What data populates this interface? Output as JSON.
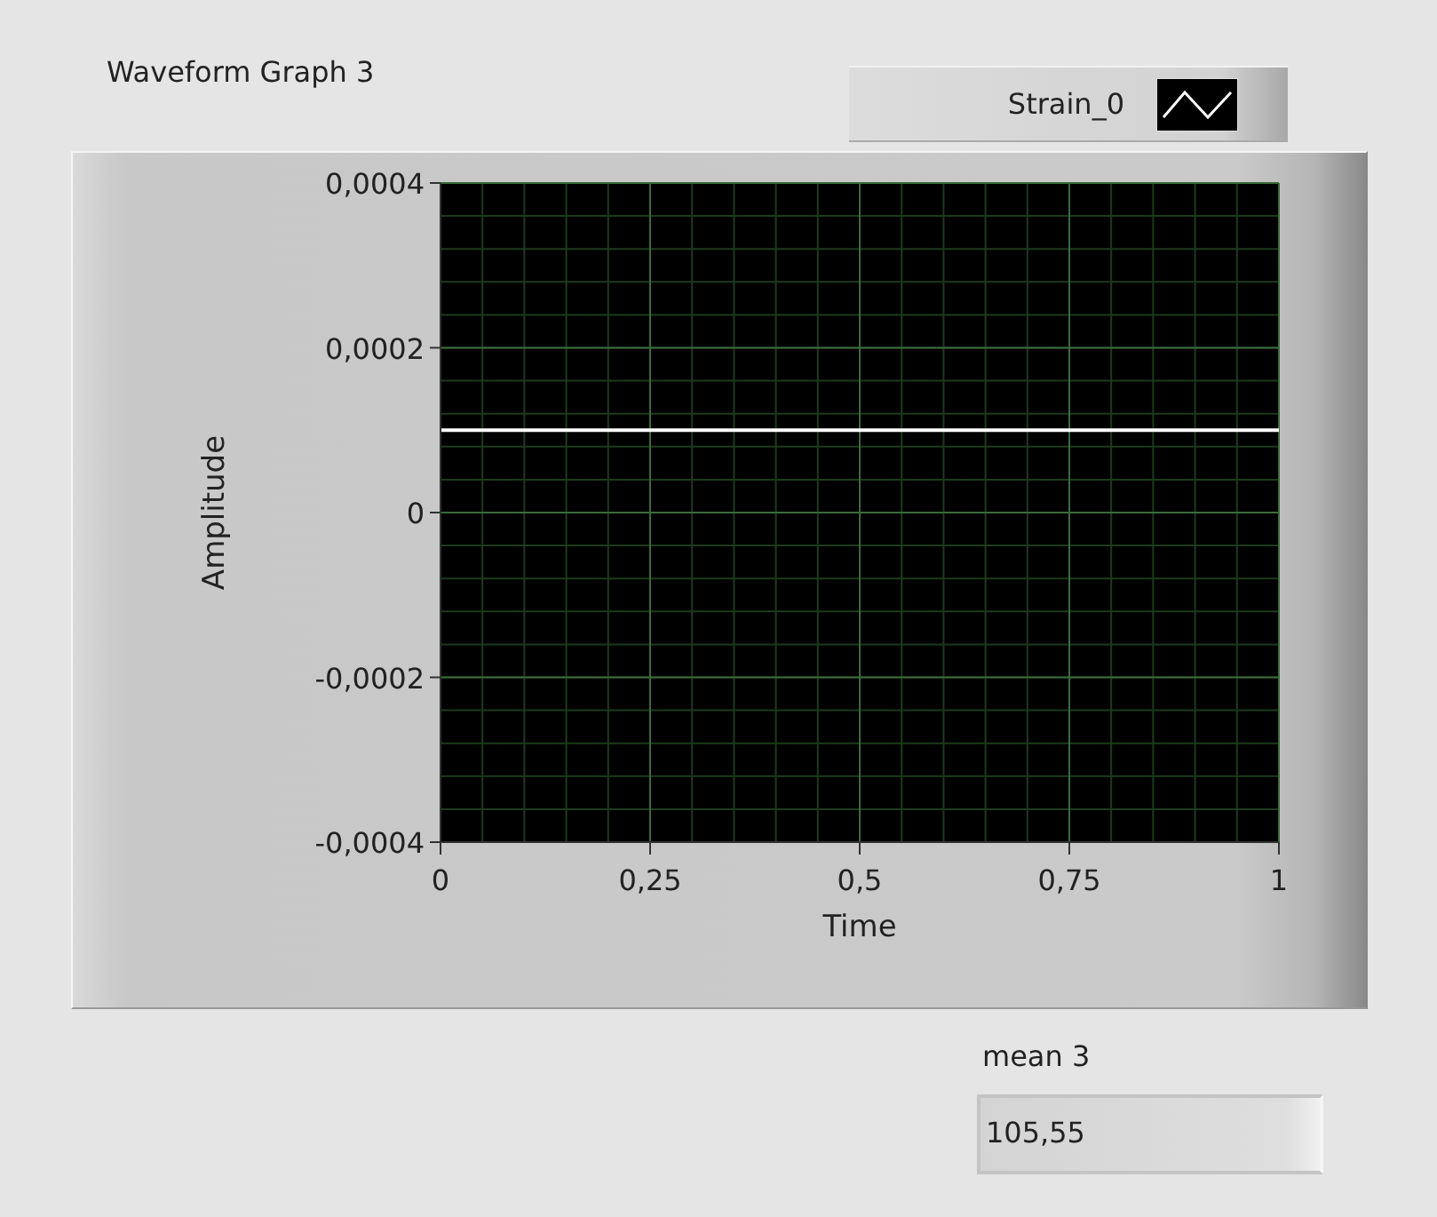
{
  "graph": {
    "chart_data": {
      "type": "line",
      "title": "Waveform Graph 3",
      "xlabel": "Time",
      "ylabel": "Amplitude",
      "grid": true,
      "x": [
        0,
        1
      ],
      "series": [
        {
          "name": "Strain_0",
          "color": "#ffffff",
          "values": [
            0.0001,
            0.0001
          ]
        }
      ],
      "xlim": [
        0,
        1
      ],
      "ylim": [
        -0.0004,
        0.0004
      ],
      "xticks": [
        {
          "value": 0,
          "label": "0"
        },
        {
          "value": 0.25,
          "label": "0,25"
        },
        {
          "value": 0.5,
          "label": "0,5"
        },
        {
          "value": 0.75,
          "label": "0,75"
        },
        {
          "value": 1,
          "label": "1"
        }
      ],
      "yticks": [
        {
          "value": 0.0004,
          "label": "0,0004"
        },
        {
          "value": 0.0002,
          "label": "0,0002"
        },
        {
          "value": 0,
          "label": "0"
        },
        {
          "value": -0.0002,
          "label": "-0,0002"
        },
        {
          "value": -0.0004,
          "label": "-0,0004"
        }
      ]
    }
  },
  "indicator": {
    "label": "mean 3",
    "value": "105,55"
  }
}
